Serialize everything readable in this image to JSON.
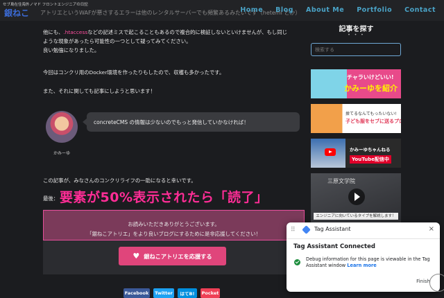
{
  "header": {
    "tagline": "セブ島在住海外ノマド フロントエンジニアの日記",
    "logo": "銀ねこ",
    "overlay_text": "アトリエというWAFが悪さするエラーは他のレンタルサーバーでも頻繁あるみたいです（heteml とか）",
    "nav": [
      "Home",
      "Blog",
      "About Me",
      "Portfolio",
      "Contact"
    ]
  },
  "article": {
    "para1_a": "他にも、",
    "para1_hl": ".htaccess",
    "para1_b": "などの記述ミスで起こることもあるので複合的に検証しないといけませんが、もし同じ",
    "para1_c": "ような現象があったら可能性の一つとして疑ってみてください。",
    "para1_d": "良い勉強になりました。",
    "para2": "今回はコンクリ用のDocker環境を作ったりもしたので、収穫も多かったです。",
    "para3": "また、それに関しても記事にしようと思います！",
    "speech_text": "concreteCMS の情報は少ないのでもっと発信していかなければ！",
    "avatar_name": "かみーゆ",
    "para4": "この記事が、みなさんのコンクリライフの一助になると幸いです。",
    "para5": "最後：",
    "overlay_big": "要素が50%表示されたら「読了」",
    "thanks_line1": "お読みいただきありがとうございます。",
    "thanks_line2": "「銀ねこアトリエ」をより良いブログにするために是非応援してください！",
    "support_button": "銀ねこアトリエを応援する",
    "share": [
      "Facebook",
      "Twitter",
      "はてB!",
      "Pocket"
    ]
  },
  "sidebar": {
    "title": "記事を探す",
    "dots": "• • •",
    "search_placeholder": "検索する",
    "banner1_top": "チャラいけどいい!",
    "banner1_main": "かみーゆを紹介",
    "banner2_top": "捨てるなんてもったいない!",
    "banner2_main": "子ども服をセブに送るプロジェクト",
    "banner3_top": "かみーゆちゃんねる",
    "banner3_main": "YouTube配信中",
    "banner4_top": "三原文学院",
    "banner4_caption": "エンジニアに向いているタイプを解説します！"
  },
  "tag_assistant": {
    "title": "Tag Assistant",
    "heading": "Tag Assistant Connected",
    "message": "Debug information for this page is viewable in the Tag Assistant window",
    "link": "Learn more",
    "finish": "Finish"
  },
  "colors": {
    "accent_pink": "#e0457b",
    "nav_blue": "#4aa3c7",
    "highlight_pink": "#ff2d96"
  }
}
